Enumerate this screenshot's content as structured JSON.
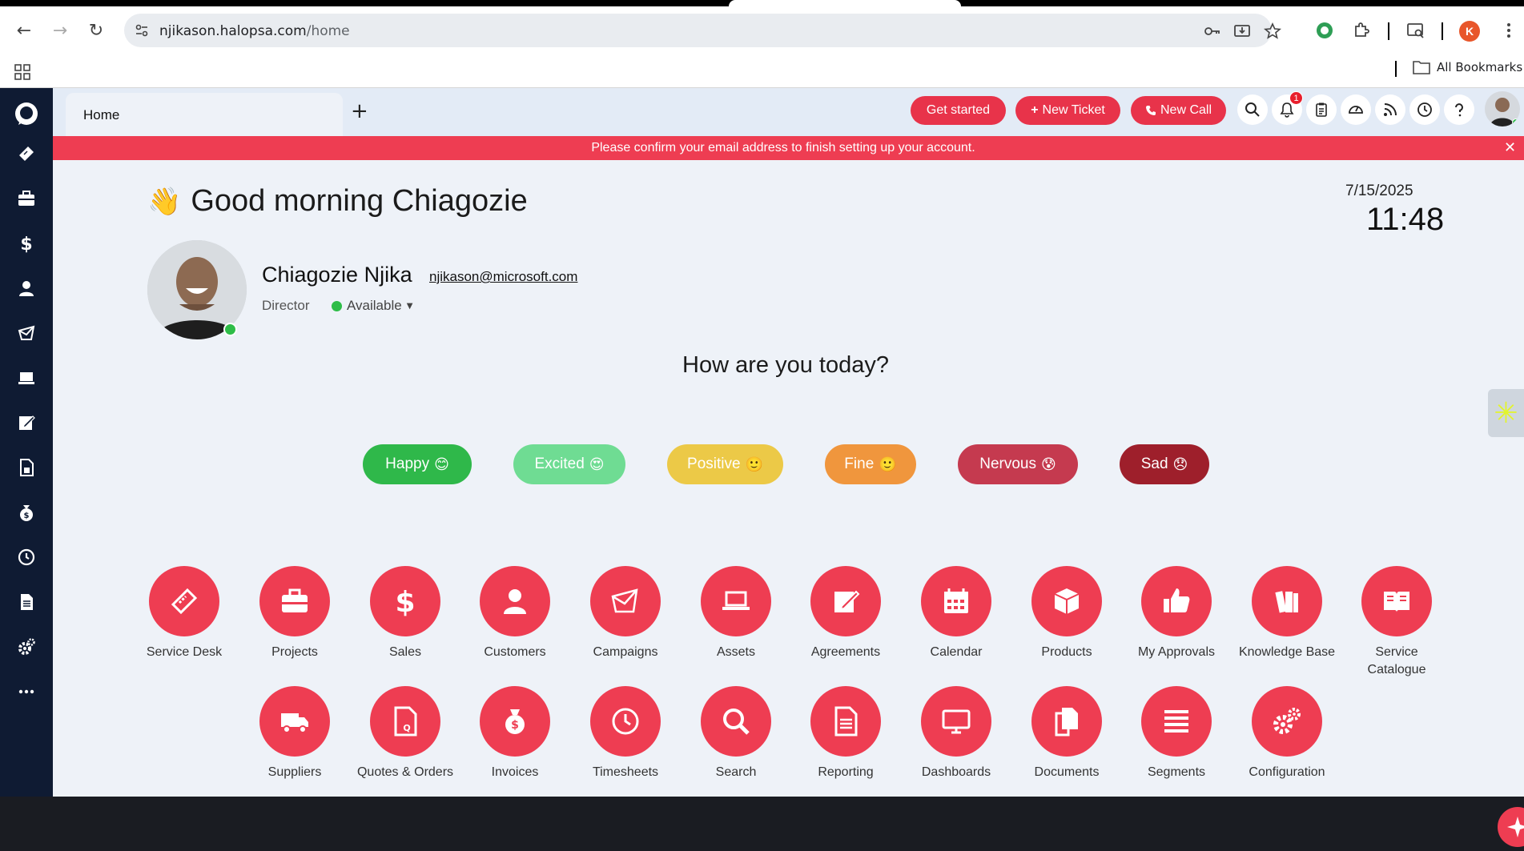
{
  "browser": {
    "url_host": "njikason.halopsa.com",
    "url_path": "/home",
    "profile_initial": "K",
    "bookmarks_label": "All Bookmarks"
  },
  "app": {
    "tab_label": "Home",
    "add_tab": "+",
    "buttons": {
      "get_started": "Get started",
      "new_ticket": "New Ticket",
      "new_call": "New Call"
    },
    "notification_count": "1",
    "banner": "Please confirm your email address to finish setting up your account.",
    "accent_color": "#ee3d52"
  },
  "greeting": {
    "emoji": "👋",
    "text": "Good morning Chiagozie",
    "date": "7/15/2025",
    "time": "11:48"
  },
  "user": {
    "name": "Chiagozie Njika",
    "email": "njikason@microsoft.com",
    "role": "Director",
    "status": "Available"
  },
  "mood": {
    "question": "How are you today?",
    "options": [
      {
        "label": "Happy",
        "emoji": "😊",
        "color": "#2fb84a"
      },
      {
        "label": "Excited",
        "emoji": "😍",
        "color": "#6fdc93"
      },
      {
        "label": "Positive",
        "emoji": "🙂",
        "color": "#ecc947"
      },
      {
        "label": "Fine",
        "emoji": "🙂",
        "color": "#f0963d"
      },
      {
        "label": "Nervous",
        "emoji": "😰",
        "color": "#c53a4f"
      },
      {
        "label": "Sad",
        "emoji": "😞",
        "color": "#9e1f2b"
      }
    ]
  },
  "modules": {
    "row1": [
      {
        "label": "Service Desk",
        "icon": "ticket-icon"
      },
      {
        "label": "Projects",
        "icon": "briefcase-icon"
      },
      {
        "label": "Sales",
        "icon": "dollar-icon"
      },
      {
        "label": "Customers",
        "icon": "person-icon"
      },
      {
        "label": "Campaigns",
        "icon": "envelope-icon"
      },
      {
        "label": "Assets",
        "icon": "laptop-icon"
      },
      {
        "label": "Agreements",
        "icon": "pen-icon"
      },
      {
        "label": "Calendar",
        "icon": "calendar-icon"
      },
      {
        "label": "Products",
        "icon": "box-icon"
      },
      {
        "label": "My Approvals",
        "icon": "thumbs-up-icon"
      },
      {
        "label": "Knowledge Base",
        "icon": "books-icon"
      },
      {
        "label": "Service Catalogue",
        "icon": "open-book-icon"
      }
    ],
    "row2": [
      {
        "label": "Suppliers",
        "icon": "truck-icon"
      },
      {
        "label": "Quotes & Orders",
        "icon": "quote-doc-icon"
      },
      {
        "label": "Invoices",
        "icon": "money-bag-icon"
      },
      {
        "label": "Timesheets",
        "icon": "clock-icon"
      },
      {
        "label": "Search",
        "icon": "search-icon"
      },
      {
        "label": "Reporting",
        "icon": "report-icon"
      },
      {
        "label": "Dashboards",
        "icon": "monitor-icon"
      },
      {
        "label": "Documents",
        "icon": "documents-icon"
      },
      {
        "label": "Segments",
        "icon": "lines-icon"
      },
      {
        "label": "Configuration",
        "icon": "gears-icon"
      }
    ]
  }
}
